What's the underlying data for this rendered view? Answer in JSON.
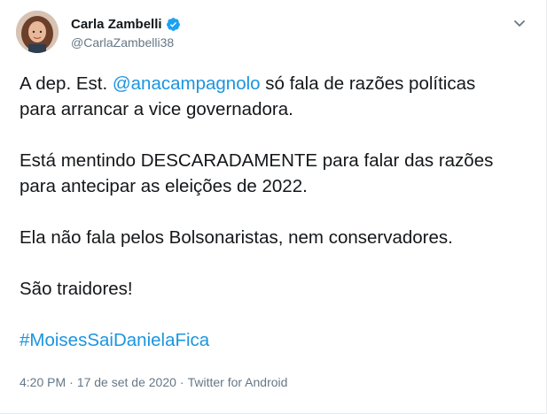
{
  "tweet": {
    "display_name": "Carla Zambelli",
    "handle": "@CarlaZambelli38",
    "line1_prefix": "A dep. Est. ",
    "line1_mention": "@anacampagnolo",
    "line1_suffix": " só fala de razões políticas",
    "line2": "para arrancar a vice governadora.",
    "para2_line1": "Está mentindo DESCARADAMENTE para falar das razões",
    "para2_line2": "para antecipar as eleições de 2022.",
    "para3": "Ela não fala pelos Bolsonaristas, nem conservadores.",
    "para4": "São traidores!",
    "hashtag": "#MoisesSaiDanielaFica",
    "time": "4:20 PM",
    "date": "17 de set de 2020",
    "source": "Twitter for Android",
    "separator": "·"
  },
  "icons": {
    "verified": "verified-badge-icon",
    "caret": "chevron-down-icon",
    "avatar": "profile-avatar"
  },
  "colors": {
    "link": "#1b95e0",
    "text": "#14171a",
    "muted": "#657786",
    "verified": "#1da1f2"
  }
}
